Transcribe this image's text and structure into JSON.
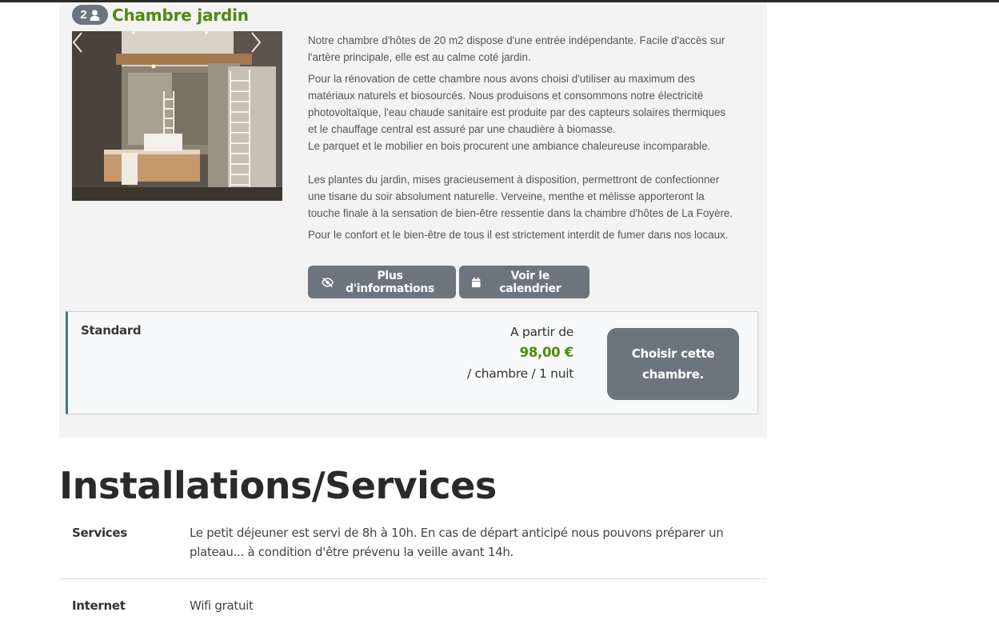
{
  "room": {
    "capacity": "2",
    "title": "Chambre jardin",
    "description": {
      "p1": [
        "Notre chambre d'hôtes de 20 m2 dispose d'une entrée indépendante. Facile d'accès sur",
        "l'artère principale, elle est au calme coté jardin."
      ],
      "p2": [
        "Pour la rénovation de cette chambre nous avons choisi d'utiliser au maximum des",
        "matériaux naturels et biosourcés. Nous produisons et consommons notre électricité",
        "photovoltaïque, l'eau chaude sanitaire est produite par des capteurs solaires thermiques",
        "et le chauffage central est assuré par une chaudière à biomasse.",
        "Le parquet et le mobilier en bois procurent une ambiance chaleureuse incomparable."
      ],
      "p3": [
        "Les plantes du jardin, mises gracieusement à disposition, permettront de confectionner",
        "une tisane du soir absolument naturelle. Verveine, menthe et mélisse apporteront la",
        "touche finale à la sensation de bien-être ressentie dans la chambre d'hôtes de La Foyère."
      ],
      "p4": "Pour le confort et le bien-être de tous il est strictement interdit de fumer dans nos locaux."
    },
    "buttons": {
      "more_info": "Plus d'informations",
      "calendar": "Voir le calendrier"
    },
    "rate": {
      "name": "Standard",
      "from_label": "A partir de",
      "price": "98,00 €",
      "unit": "/ chambre / 1 nuit",
      "choose_label": "Choisir cette chambre."
    }
  },
  "services_section": {
    "title": "Installations/Services",
    "rows": [
      {
        "label": "Services",
        "value": "Le petit déjeuner est servi de 8h à 10h. En cas de départ anticipé nous pouvons préparer un plateau... à condition d'être prévenu la veille avant 14h."
      },
      {
        "label": "Internet",
        "value": "Wifi gratuit"
      }
    ]
  },
  "colors": {
    "accent_green": "#4f8a10",
    "button_gray": "#6c757d",
    "rate_border": "#3d7d78"
  },
  "icons": [
    "person-icon",
    "eye-slash-icon",
    "calendar-icon",
    "chevron-left-icon",
    "chevron-right-icon"
  ]
}
